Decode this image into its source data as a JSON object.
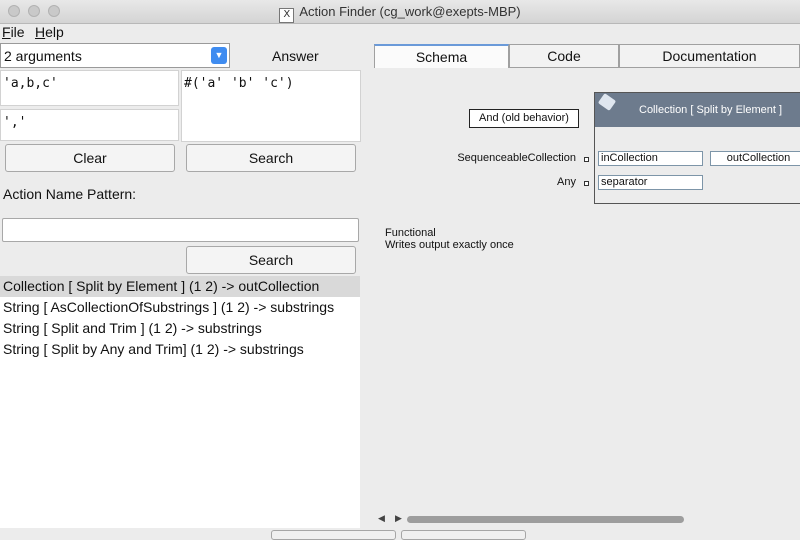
{
  "window": {
    "title": "Action Finder (cg_work@exepts-MBP)",
    "icon": "x11-icon"
  },
  "menu": {
    "file_u": "F",
    "file_rest": "ile",
    "help_u": "H",
    "help_rest": "elp"
  },
  "args": {
    "selected": "2 arguments"
  },
  "answer_label": "Answer",
  "arg1_value": "'a,b,c'",
  "arg2_value": "','",
  "answer_value": "#('a' 'b' 'c')",
  "buttons": {
    "clear": "Clear",
    "search_top": "Search",
    "search_bottom": "Search"
  },
  "pattern": {
    "label": "Action Name Pattern:",
    "value": ""
  },
  "results": [
    "Collection [ Split by Element ] (1 2) -> outCollection",
    "String [ AsCollectionOfSubstrings ] (1 2) -> substrings",
    "String [ Split and Trim ] (1 2) -> substrings",
    "String [ Split by Any and Trim] (1 2) -> substrings"
  ],
  "tabs": [
    "Schema",
    "Code",
    "Documentation"
  ],
  "schema": {
    "and_box": "And (old behavior)",
    "inputs": [
      {
        "label": "SequenceableCollection",
        "slot": "inCollection"
      },
      {
        "label": "Any",
        "slot": "separator"
      }
    ],
    "node_title": "Collection [ Split by Element ]",
    "output_slot": "outCollection",
    "desc_line1": "Functional",
    "desc_line2": "Writes output exactly once"
  }
}
